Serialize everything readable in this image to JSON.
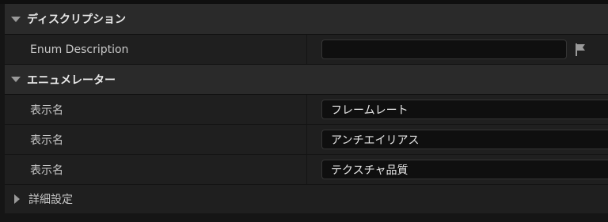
{
  "sections": {
    "description": {
      "title": "ディスクリプション",
      "property_label": "Enum Description",
      "property_value": ""
    },
    "enumerators": {
      "title": "エニュメレーター",
      "items": [
        {
          "label": "表示名",
          "value": "フレームレート"
        },
        {
          "label": "表示名",
          "value": "アンチエイリアス"
        },
        {
          "label": "表示名",
          "value": "テクスチャ品質"
        }
      ]
    },
    "advanced": {
      "title": "詳細設定"
    }
  },
  "icons": {
    "expand": "triangle-down-icon",
    "collapse": "triangle-right-icon",
    "localize": "flag-icon"
  },
  "colors": {
    "accent": "#1d6fd1",
    "header_bg": "#2a2a2a",
    "row_bg": "#1f1f1f",
    "field_bg": "#0f0f0f"
  }
}
